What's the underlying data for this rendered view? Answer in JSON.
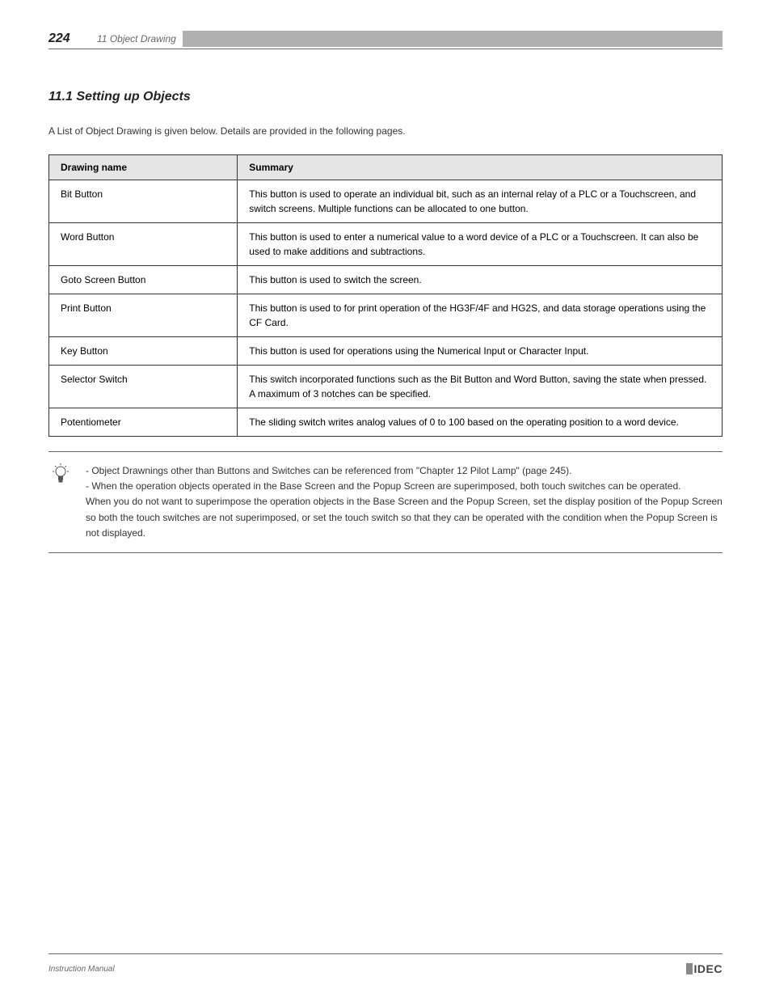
{
  "header": {
    "page_number": "224",
    "chapter": "11",
    "chapter_title": "Object Drawing"
  },
  "section": {
    "title": "11.1  Setting up Objects",
    "intro": "A List of Object Drawing is given below. Details are provided in the following pages."
  },
  "table": {
    "headers": {
      "left": "Drawing name",
      "right": "Summary"
    },
    "rows": [
      {
        "left": "Bit Button",
        "right": "This button is used to operate an individual bit, such as an internal relay of a PLC or a Touchscreen, and switch screens. Multiple functions can be allocated to one button."
      },
      {
        "left": "Word Button",
        "right": "This button is used to enter a numerical value to a word device of a PLC or a Touchscreen. It can also be used to make additions and subtractions."
      },
      {
        "left": "Goto Screen Button",
        "right": "This button is used to switch the screen."
      },
      {
        "left": "Print Button",
        "right": "This button is used to for print operation of the HG3F/4F and HG2S, and data storage operations using the CF Card."
      },
      {
        "left": "Key Button",
        "right": "This button is used for operations using the Numerical Input or Character Input."
      },
      {
        "left": "Selector Switch",
        "right": "This switch incorporated functions such as the Bit Button and Word Button, saving the state when pressed. A maximum of 3 notches can be specified."
      },
      {
        "left": "Potentiometer",
        "right": "The sliding switch writes analog values of 0 to 100 based on the operating position to a word device."
      }
    ]
  },
  "note": {
    "line1": "- Object Drawnings other than Buttons and Switches can be referenced from \"Chapter 12 Pilot Lamp\" (page 245).",
    "line2": "- When the operation objects operated in the Base Screen and the Popup Screen are superimposed, both touch switches can be operated.",
    "line3": "When you do not want to superimpose the operation objects in the Base Screen and the Popup Screen, set the display position of the Popup Screen so both the touch switches are not superimposed, or set the touch switch so that they can be operated with the condition when the Popup Screen is not displayed."
  },
  "footer": {
    "text": "Instruction Manual",
    "logo": "IDEC"
  }
}
